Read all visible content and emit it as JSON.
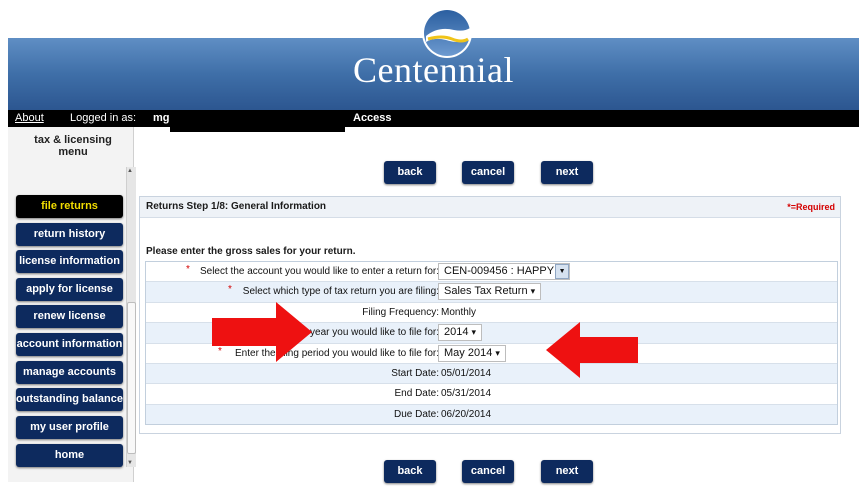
{
  "brand": {
    "name": "Centennial"
  },
  "infobar": {
    "about": "About",
    "logged_in_label": "Logged in as:",
    "user": "mgodfr",
    "access": "Access"
  },
  "sidebar": {
    "title": "tax & licensing menu",
    "items": [
      {
        "label": "file returns",
        "active": true
      },
      {
        "label": "return history"
      },
      {
        "label": "license information"
      },
      {
        "label": "apply for license"
      },
      {
        "label": "renew license"
      },
      {
        "label": "account information"
      },
      {
        "label": "manage accounts"
      },
      {
        "label": "outstanding balances"
      },
      {
        "label": "my user profile"
      },
      {
        "label": "home"
      }
    ]
  },
  "actions": {
    "back": "back",
    "cancel": "cancel",
    "next": "next"
  },
  "step": {
    "title": "Returns Step 1/8: General Information",
    "required_note": "*=Required"
  },
  "instruction": "Please enter the gross sales for your return.",
  "form": {
    "account_label": "Select the account you would like to enter a return for:",
    "account_value": "CEN-009456 : HAPPY",
    "type_label": "Select which type of tax return you are filing:",
    "type_value": "Sales Tax Return",
    "frequency_label": "Filing Frequency:",
    "frequency_value": "Monthly",
    "year_label": "the year you would like to file for:",
    "year_value": "2014",
    "period_label": "Enter the filing period you would like to file for:",
    "period_value": "May 2014",
    "start_label": "Start Date:",
    "start_value": "05/01/2014",
    "end_label": "End Date:",
    "end_value": "05/31/2014",
    "due_label": "Due Date:",
    "due_value": "06/20/2014"
  },
  "colors": {
    "header_blue": "#3f6fa8",
    "nav_navy": "#0d2a5e",
    "active_text": "#f2dd00",
    "required_red": "#d40000",
    "annotation_arrow": "#ee1111"
  }
}
